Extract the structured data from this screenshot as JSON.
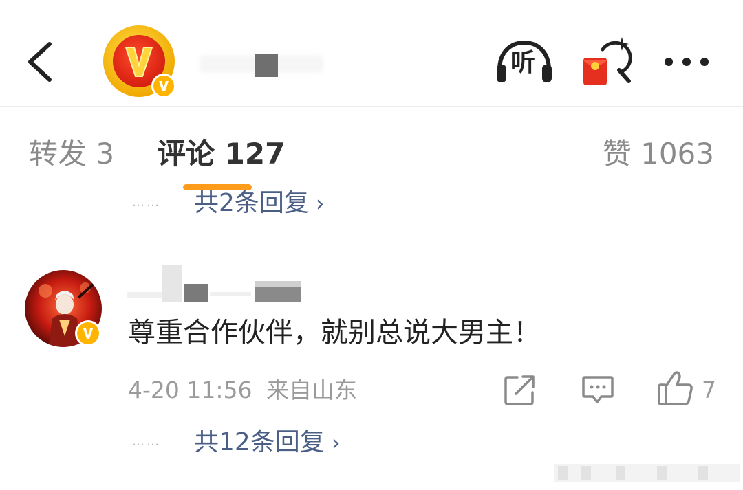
{
  "header": {
    "back_icon": "chevron-left-icon",
    "avatar_icon": "gold-v-badge-icon",
    "listen_label": "听",
    "redpacket_icon": "red-packet-search-icon",
    "more_icon": "more-dots-icon"
  },
  "tabs": {
    "repost": "转发 3",
    "comment": "评论 127",
    "like": "赞 1063",
    "accent_color": "#ff9c1b"
  },
  "replies_top": {
    "dots": "……",
    "label": "共2条回复"
  },
  "comment": {
    "text": "尊重合作伙伴，就别总说大男主！",
    "time": "4-20 11:56",
    "location": "来自山东",
    "like_count": "7"
  },
  "replies_bottom": {
    "dots": "……",
    "label": "共12条回复"
  },
  "colors": {
    "link": "#4b5f86",
    "muted": "#9a9a9a",
    "accent": "#ff9c1b"
  }
}
